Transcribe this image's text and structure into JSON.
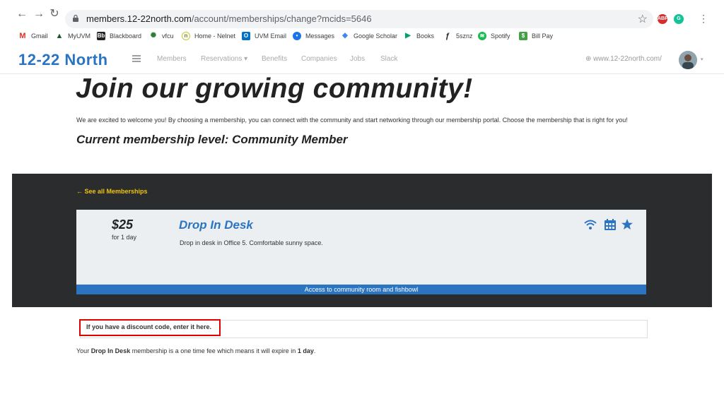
{
  "browser": {
    "url_host": "members.12-22north.com",
    "url_path": "/account/memberships/change?mcids=5646",
    "ext_abp": "ABP",
    "ext_g": "G",
    "menu": "⋮"
  },
  "bookmarks": [
    {
      "label": "Gmail"
    },
    {
      "label": "MyUVM"
    },
    {
      "label": "Blackboard"
    },
    {
      "label": "vfcu"
    },
    {
      "label": "Home - Nelnet"
    },
    {
      "label": "UVM Email"
    },
    {
      "label": "Messages"
    },
    {
      "label": "Google Scholar"
    },
    {
      "label": "Books"
    },
    {
      "label": "5sznz"
    },
    {
      "label": "Spotify"
    },
    {
      "label": "Bill Pay"
    }
  ],
  "site": {
    "logo": "12-22 North",
    "nav": [
      "Members",
      "Reservations",
      "Benefits",
      "Companies",
      "Jobs",
      "Slack"
    ],
    "reservations_caret": "▾",
    "external_link": "www.12-22north.com/",
    "account_caret": "▾"
  },
  "page": {
    "title": "Join our growing community!",
    "welcome": "We are excited to welcome you! By choosing a membership, you can connect with the community and start networking through our membership portal. Choose the membership that is right for you!",
    "current_level": "Current membership level: Community Member"
  },
  "membership": {
    "back_link": "See all Memberships",
    "price": "$25",
    "period": "for 1 day",
    "name": "Drop In Desk",
    "description": "Drop in desk in Office 5. Comfortable sunny space.",
    "footer": "Access to community room and fishbowl"
  },
  "discount": {
    "prompt": "If you have a discount code, enter it here."
  },
  "fee": {
    "prefix": "Your ",
    "name": "Drop In Desk",
    "middle": " membership is a one time fee which means it will expire in ",
    "duration": "1 day",
    "suffix": "."
  },
  "colors": {
    "brand": "#2a74c1",
    "dark": "#2a2c2e",
    "accent_link": "#f1c40f",
    "highlight": "#e00000"
  }
}
